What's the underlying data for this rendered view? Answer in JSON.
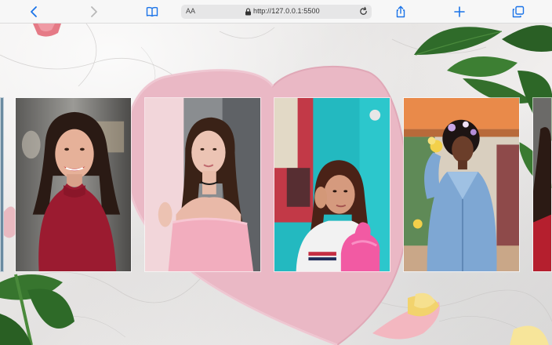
{
  "browser": {
    "text_size_label": "AA",
    "url": "http://127.0.0.1:5500"
  },
  "gallery": {
    "photos": [
      {
        "name": "woman-red-sweater"
      },
      {
        "name": "woman-pink-offshoulder"
      },
      {
        "name": "woman-teal-wall-pink-cone"
      },
      {
        "name": "woman-denim-jacket-flowers"
      }
    ]
  },
  "colors": {
    "accent_blue": "#1a73e8",
    "heart_pink": "#eab8c5"
  }
}
